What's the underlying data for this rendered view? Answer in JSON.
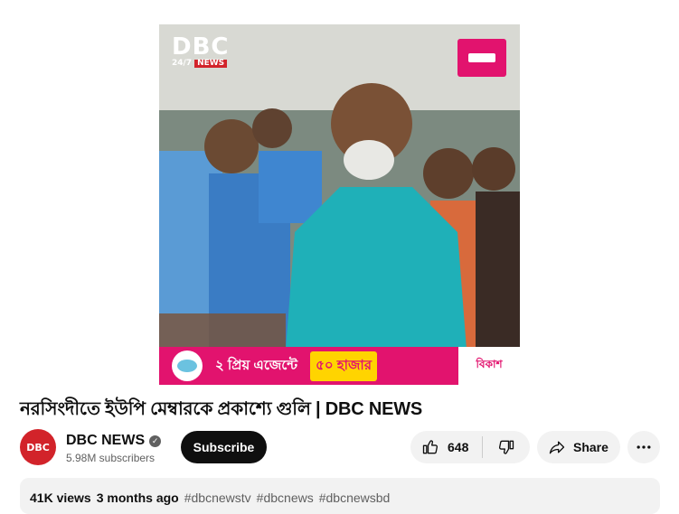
{
  "video": {
    "overlay": {
      "logo_text": "DBC",
      "logo_sub_a": "24/7",
      "logo_sub_b": "NEWS",
      "ad_text_1": "২ প্রিয় এজেন্টে",
      "ad_highlight": "৫০ হাজার",
      "ad_brand": "বিকাশ"
    },
    "title": "নরসিংদীতে ইউপি মেম্বারকে প্রকাশ্যে গুলি | DBC NEWS"
  },
  "channel": {
    "avatar_text": "DBC",
    "name": "DBC NEWS",
    "subscribers": "5.98M subscribers",
    "verified_icon": "checkmark-circle-icon"
  },
  "actions": {
    "subscribe_label": "Subscribe",
    "like_count": "648",
    "share_label": "Share",
    "icons": {
      "like": "thumbs-up-icon",
      "dislike": "thumbs-down-icon",
      "share": "share-arrow-icon",
      "more": "more-horizontal-icon"
    }
  },
  "description": {
    "views": "41K views",
    "age": "3 months ago",
    "hashtags": [
      "#dbcnewstv",
      "#dbcnews",
      "#dbcnewsbd"
    ]
  },
  "colors": {
    "brand_red": "#d2232a",
    "bkash_pink": "#e2136e",
    "subscribe_bg": "#0f0f0f",
    "chip_bg": "#f2f2f2"
  }
}
